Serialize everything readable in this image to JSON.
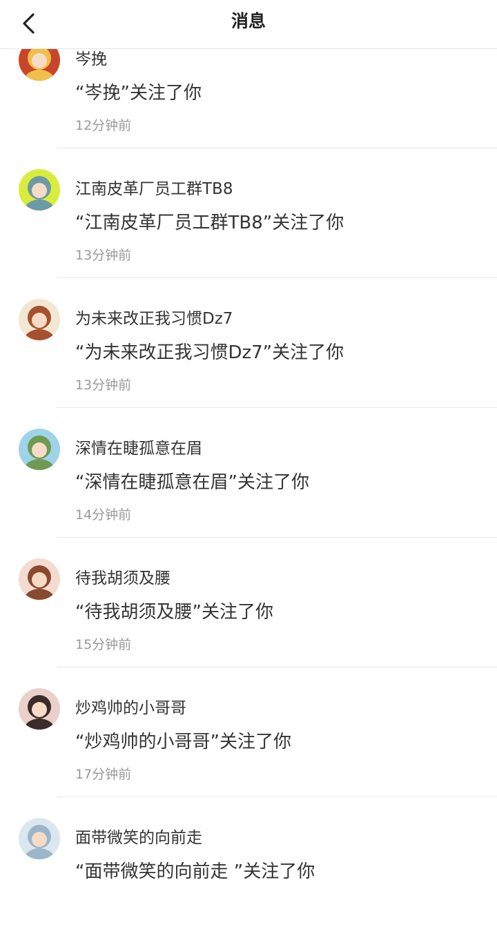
{
  "header": {
    "title": "消息",
    "back_icon": "chevron-left-icon"
  },
  "notifications": [
    {
      "name": "岑挽",
      "message": "“岑挽”关注了你",
      "time": "12分钟前",
      "avatar_colors": [
        "#c9452a",
        "#f1c04a"
      ]
    },
    {
      "name": "江南皮革厂员工群TB8",
      "message": "“江南皮革厂员工群TB8”关注了你",
      "time": "13分钟前",
      "avatar_colors": [
        "#d9ec3c",
        "#6c9aa6"
      ]
    },
    {
      "name": "为未来改正我习惯Dz7",
      "message": "“为未来改正我习惯Dz7”关注了你",
      "time": "13分钟前",
      "avatar_colors": [
        "#f1e7d2",
        "#a7502e"
      ]
    },
    {
      "name": "深情在睫孤意在眉",
      "message": "“深情在睫孤意在眉”关注了你",
      "time": "14分钟前",
      "avatar_colors": [
        "#9ed3e8",
        "#6f9a52"
      ]
    },
    {
      "name": "待我胡须及腰",
      "message": "“待我胡须及腰”关注了你",
      "time": "15分钟前",
      "avatar_colors": [
        "#f3dccf",
        "#8a4a2f"
      ]
    },
    {
      "name": "炒鸡帅的小哥哥",
      "message": "“炒鸡帅的小哥哥”关注了你",
      "time": "17分钟前",
      "avatar_colors": [
        "#ead0c8",
        "#3c2b2b"
      ]
    },
    {
      "name": "面带微笑的向前走",
      "message": "“面带微笑的向前走 ”关注了你",
      "time": "",
      "avatar_colors": [
        "#dbe7ef",
        "#9bb6c9"
      ]
    }
  ]
}
